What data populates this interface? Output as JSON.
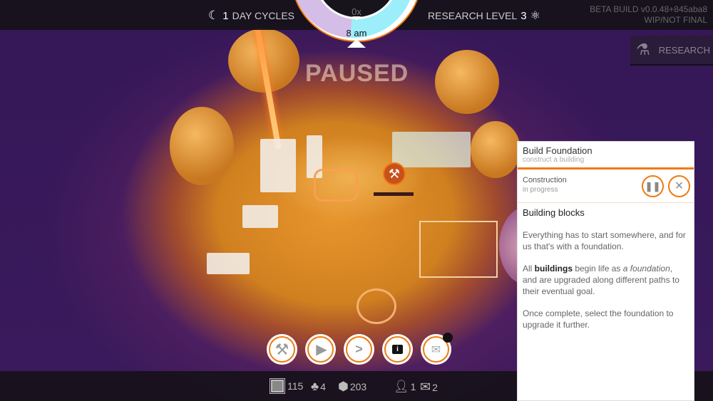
{
  "hud": {
    "day_cycles_count": "1",
    "day_cycles_label": "DAY CYCLES",
    "research_level_label": "RESEARCH LEVEL",
    "research_level": "3",
    "beta_line1": "BETA BUILD v0.0.48+845aba8",
    "beta_line2": "WIP/NOT FINAL"
  },
  "clock": {
    "speed": "0x",
    "time": "8 am",
    "colors": {
      "night": "#d4bde6",
      "day": "#9ceefb",
      "accent": "#f07a10"
    }
  },
  "research_button": {
    "label": "RESEARCH"
  },
  "scene": {
    "status": "PAUSED"
  },
  "action_buttons": [
    {
      "icon": "hammers-icon"
    },
    {
      "icon": "play-icon"
    },
    {
      "icon": "fast-forward-icon"
    },
    {
      "icon": "info-icon"
    },
    {
      "icon": "mail-icon",
      "has_notification": true
    }
  ],
  "stats": {
    "chips": "115",
    "trees": "4",
    "materials": "203",
    "population": "1",
    "messages": "2"
  },
  "panel": {
    "title": "Build Foundation",
    "subtitle": "construct a building",
    "status_title": "Construction",
    "status_sub": "in progress",
    "heading": "Building blocks",
    "p1": "Everything has to start somewhere, and for us that's with a foundation.",
    "p2_a": "All ",
    "p2_b": "buildings",
    "p2_c": " begin life as ",
    "p2_d": "a foundation",
    "p2_e": ", and are upgraded along different paths to their eventual goal.",
    "p3": "Once complete, select the foundation to upgrade it further."
  }
}
